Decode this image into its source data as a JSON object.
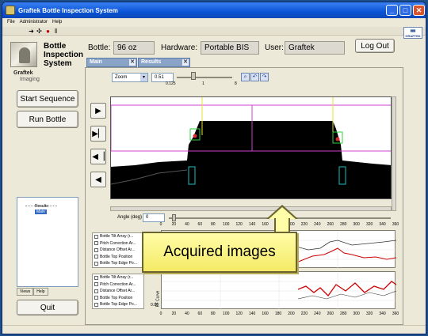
{
  "window": {
    "title": "Graftek Bottle Inspection System"
  },
  "menu": [
    "File",
    "Administrator",
    "Help"
  ],
  "app": {
    "system_title_line1": "Bottle",
    "system_title_line2": "Inspection",
    "system_title_line3": "System",
    "logo_line1": "Graftek",
    "logo_line2": "Imaging"
  },
  "header": {
    "bottle_label": "Bottle:",
    "bottle_value": "96 oz",
    "hardware_label": "Hardware:",
    "hardware_value": "Portable BIS",
    "user_label": "User:",
    "user_value": "Graftek",
    "logout": "Log Out"
  },
  "tabs": [
    {
      "label": "Main"
    },
    {
      "label": "Results"
    }
  ],
  "left": {
    "start": "Start Sequence",
    "run": "Run Bottle",
    "quit": "Quit"
  },
  "tree": {
    "results": "Results",
    "main": "Main"
  },
  "view_tabs": [
    "Views",
    "Help"
  ],
  "zoom": {
    "mode": "Zoom",
    "value": "0.51",
    "ticks": [
      "0.125",
      "1",
      "8"
    ]
  },
  "angle": {
    "label": "Angle (deg)",
    "value": "0"
  },
  "scale_ticks": [
    "0",
    "20",
    "40",
    "60",
    "80",
    "100",
    "120",
    "140",
    "160",
    "180",
    "200",
    "220",
    "240",
    "260",
    "280",
    "300",
    "320",
    "340",
    "360"
  ],
  "legend_top": [
    "Bottle Tilt Array (r...",
    "Pitch Correction Ar...",
    "Distance Offset Ar...",
    "Bottle Top Position",
    "Bottle Top Edge Po..."
  ],
  "legend_bottom": [
    "Bottle Tilt Array (r...",
    "Pitch Correction Ar...",
    "Distance Offset Ar...",
    "Bottle Top Position",
    "Bottle Top Edge Po..."
  ],
  "chart_bottom_label": "FF Curve",
  "chart_bottom_ytick": "0.06",
  "callout": "Acquired images",
  "colors": {
    "titlebar": "#0a53d6",
    "callout": "#fffda8",
    "curve_red": "#cc0000",
    "curve_dark": "#333333"
  }
}
